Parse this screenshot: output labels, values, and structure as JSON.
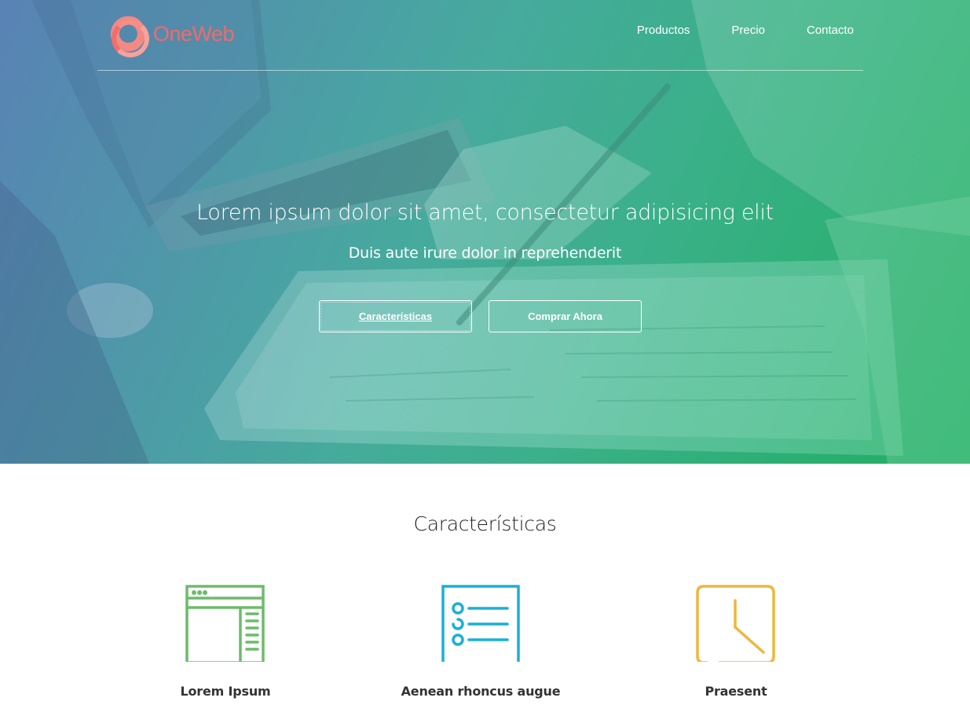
{
  "brand": {
    "name": "OneWeb",
    "color": "#f26a6a"
  },
  "nav": {
    "items": [
      {
        "label": "Productos"
      },
      {
        "label": "Precio"
      },
      {
        "label": "Contacto"
      }
    ]
  },
  "hero": {
    "title": "Lorem ipsum dolor sit amet, consectetur adipisicing elit",
    "subtitle": "Duis aute irure dolor in reprehenderit",
    "buttons": {
      "features": "Características",
      "buy": "Comprar Ahora"
    }
  },
  "features": {
    "title": "Características",
    "items": [
      {
        "label": "Lorem Ipsum",
        "icon": "browser-window-icon",
        "color": "#6dbb6a"
      },
      {
        "label": "Aenean rhoncus augue",
        "icon": "checklist-icon",
        "color": "#1aafd6"
      },
      {
        "label": "Praesent",
        "icon": "clock-icon",
        "color": "#f0b53c"
      }
    ]
  }
}
